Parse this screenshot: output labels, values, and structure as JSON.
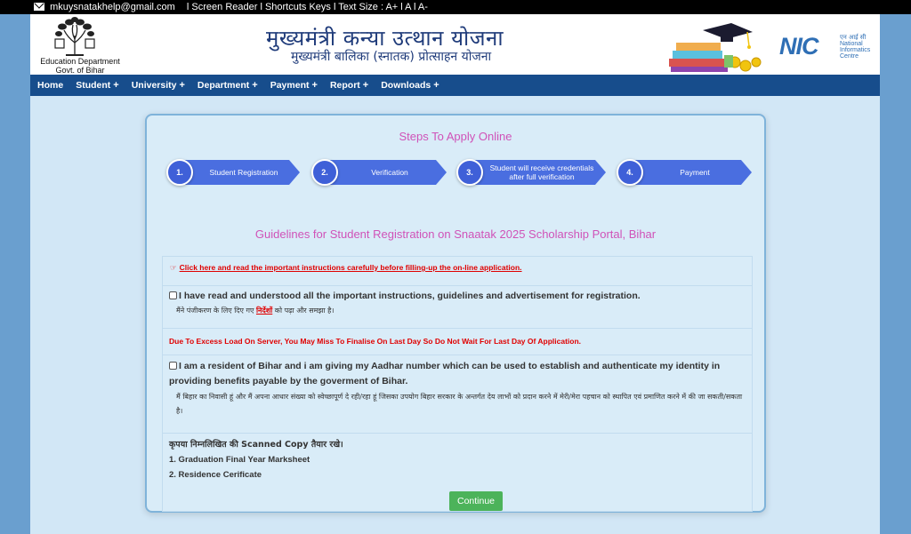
{
  "topbar": {
    "email": "mkuysnatakhelp@gmail.com",
    "links": "l Screen Reader l Shortcuts Keys l   Text Size : A+ l A   l   A-"
  },
  "header": {
    "dept_line1": "Education Department",
    "dept_line2": "Govt. of Bihar",
    "title_hi": "मुख्यमंत्री कन्या उत्थान योजना",
    "subtitle_hi": "मुख्यमंत्री बालिका (स्नातक) प्रोत्साहन योजना",
    "nic_hi": "एन आई सी",
    "nic_logo": "NIC",
    "nic_line1": "National",
    "nic_line2": "Informatics",
    "nic_line3": "Centre"
  },
  "nav": {
    "items": [
      "Home",
      "Student",
      "University",
      "Department",
      "Payment",
      "Report",
      "Downloads"
    ],
    "plus": "+"
  },
  "steps": {
    "title": "Steps To Apply Online",
    "items": [
      {
        "num": "1.",
        "label": "Student Registration"
      },
      {
        "num": "2.",
        "label": "Verification"
      },
      {
        "num": "3.",
        "label": "Student will receive credentials after full verification"
      },
      {
        "num": "4.",
        "label": "Payment"
      }
    ]
  },
  "guidelines": {
    "title": "Guidelines for Student Registration on Snaatak 2025 Scholarship Portal, Bihar",
    "instruction_link": "Click here and read the important instructions carefully before filling-up the on-line application.",
    "check1_en": "I have read and understood all the important instructions, guidelines and advertisement for registration.",
    "check1_hi_pre": "मैंने पंजीकरण के लिए दिए गए ",
    "check1_hi_link": "निर्देशों",
    "check1_hi_post": " को पढ़ा और समझा है।",
    "warning": "Due To Excess Load On Server, You May Miss To Finalise On Last Day So Do Not Wait For Last Day Of Application.",
    "check2_en": "I am a resident of Bihar and i am giving my Aadhar number which can be used to establish and authenticate my identity in providing benefits payable by the goverment of Bihar.",
    "check2_hi": "मैं बिहार का निवासी हूं और मैं अपना आधार संख्या को स्वेच्छापूर्ण दे रही/रहा हूं जिसका उपयोग बिहार सरकार के अन्तर्गत देय लाभों को प्रदान करने में मेरी/मेरा पहचान को स्थापित एवं प्रमाणित करने में की जा सकती/सकता है।",
    "docs_heading": "कृपया निम्नलिखित की Scanned Copy तैयार रखे।",
    "doc1": "1. Graduation Final Year Marksheet",
    "doc2": "2. Residence Cerificate",
    "continue_label": "Continue"
  }
}
